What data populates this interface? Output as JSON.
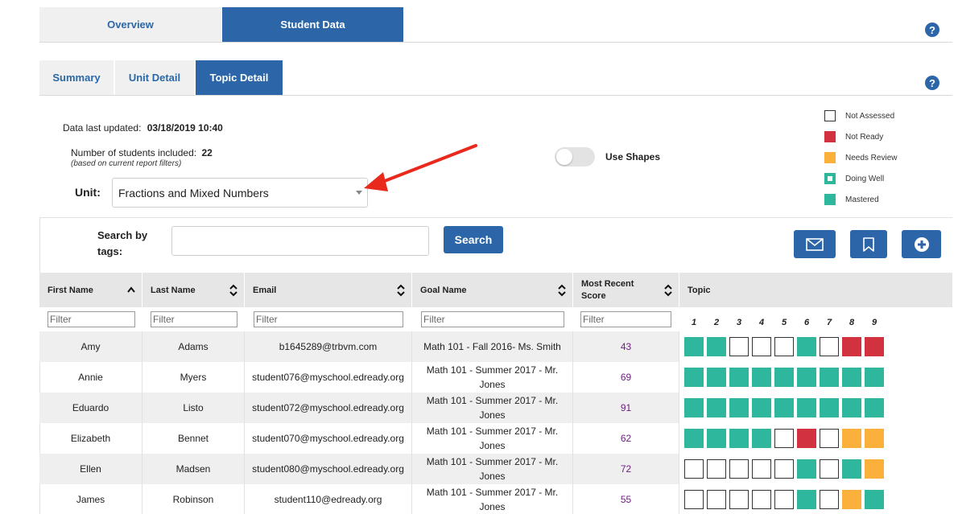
{
  "top_tabs": {
    "overview": "Overview",
    "student_data": "Student Data"
  },
  "help": "?",
  "sub_tabs": {
    "summary": "Summary",
    "unit_detail": "Unit Detail",
    "topic_detail": "Topic Detail"
  },
  "info": {
    "updated_label": "Data last updated:",
    "updated_value": "03/18/2019 10:40",
    "students_label": "Number of students included:",
    "students_value": "22",
    "filter_note": "(based on current report filters)"
  },
  "unit": {
    "label": "Unit:",
    "value": "Fractions and Mixed Numbers"
  },
  "use_shapes": {
    "label": "Use Shapes",
    "on": false
  },
  "legend": [
    {
      "label": "Not Assessed",
      "status": "na"
    },
    {
      "label": "Not Ready",
      "status": "nr"
    },
    {
      "label": "Needs Review",
      "status": "rv"
    },
    {
      "label": "Doing Well",
      "status": "dw"
    },
    {
      "label": "Mastered",
      "status": "ms"
    }
  ],
  "colors": {
    "primary": "#2c66a8",
    "not_ready": "#d2323f",
    "needs_review": "#fbb03b",
    "mastered": "#2eb79d",
    "score": "#6b1f7b",
    "annotation_arrow": "#e8291c"
  },
  "search": {
    "label_line1": "Search by",
    "label_line2": "tags:",
    "button": "Search"
  },
  "actions": [
    "mail-icon",
    "bookmark-icon",
    "add-icon"
  ],
  "columns": {
    "first_name": "First Name",
    "last_name": "Last Name",
    "email": "Email",
    "goal_name": "Goal Name",
    "score_line1": "Most Recent",
    "score_line2": "Score",
    "topic": "Topic"
  },
  "filter_placeholder": "Filter",
  "topic_numbers": [
    "1",
    "2",
    "3",
    "4",
    "5",
    "6",
    "7",
    "8",
    "9"
  ],
  "students": [
    {
      "first": "Amy",
      "last": "Adams",
      "email": "b1645289@trbvm.com",
      "goal1": "Math 101 - Fall 2016- Ms. Smith",
      "goal2": "",
      "score": "43",
      "topics": [
        "ms",
        "ms",
        "na",
        "na",
        "na",
        "ms",
        "na",
        "nr",
        "nr"
      ]
    },
    {
      "first": "Annie",
      "last": "Myers",
      "email": "student076@myschool.edready.org",
      "goal1": "Math 101 - Summer 2017 - Mr.",
      "goal2": "Jones",
      "score": "69",
      "topics": [
        "ms",
        "ms",
        "ms",
        "ms",
        "ms",
        "ms",
        "ms",
        "ms",
        "ms"
      ]
    },
    {
      "first": "Eduardo",
      "last": "Listo",
      "email": "student072@myschool.edready.org",
      "goal1": "Math 101 - Summer 2017 - Mr.",
      "goal2": "Jones",
      "score": "91",
      "topics": [
        "ms",
        "ms",
        "ms",
        "ms",
        "ms",
        "ms",
        "ms",
        "ms",
        "ms"
      ]
    },
    {
      "first": "Elizabeth",
      "last": "Bennet",
      "email": "student070@myschool.edready.org",
      "goal1": "Math 101 - Summer 2017 - Mr.",
      "goal2": "Jones",
      "score": "62",
      "topics": [
        "ms",
        "ms",
        "ms",
        "ms",
        "na",
        "nr",
        "na",
        "rv",
        "rv"
      ]
    },
    {
      "first": "Ellen",
      "last": "Madsen",
      "email": "student080@myschool.edready.org",
      "goal1": "Math 101 - Summer 2017 - Mr.",
      "goal2": "Jones",
      "score": "72",
      "topics": [
        "na",
        "na",
        "na",
        "na",
        "na",
        "ms",
        "na",
        "ms",
        "rv"
      ]
    },
    {
      "first": "James",
      "last": "Robinson",
      "email": "student110@edready.org",
      "goal1": "Math 101 - Summer 2017 - Mr.",
      "goal2": "Jones",
      "score": "55",
      "topics": [
        "na",
        "na",
        "na",
        "na",
        "na",
        "ms",
        "na",
        "rv",
        "ms"
      ]
    }
  ]
}
